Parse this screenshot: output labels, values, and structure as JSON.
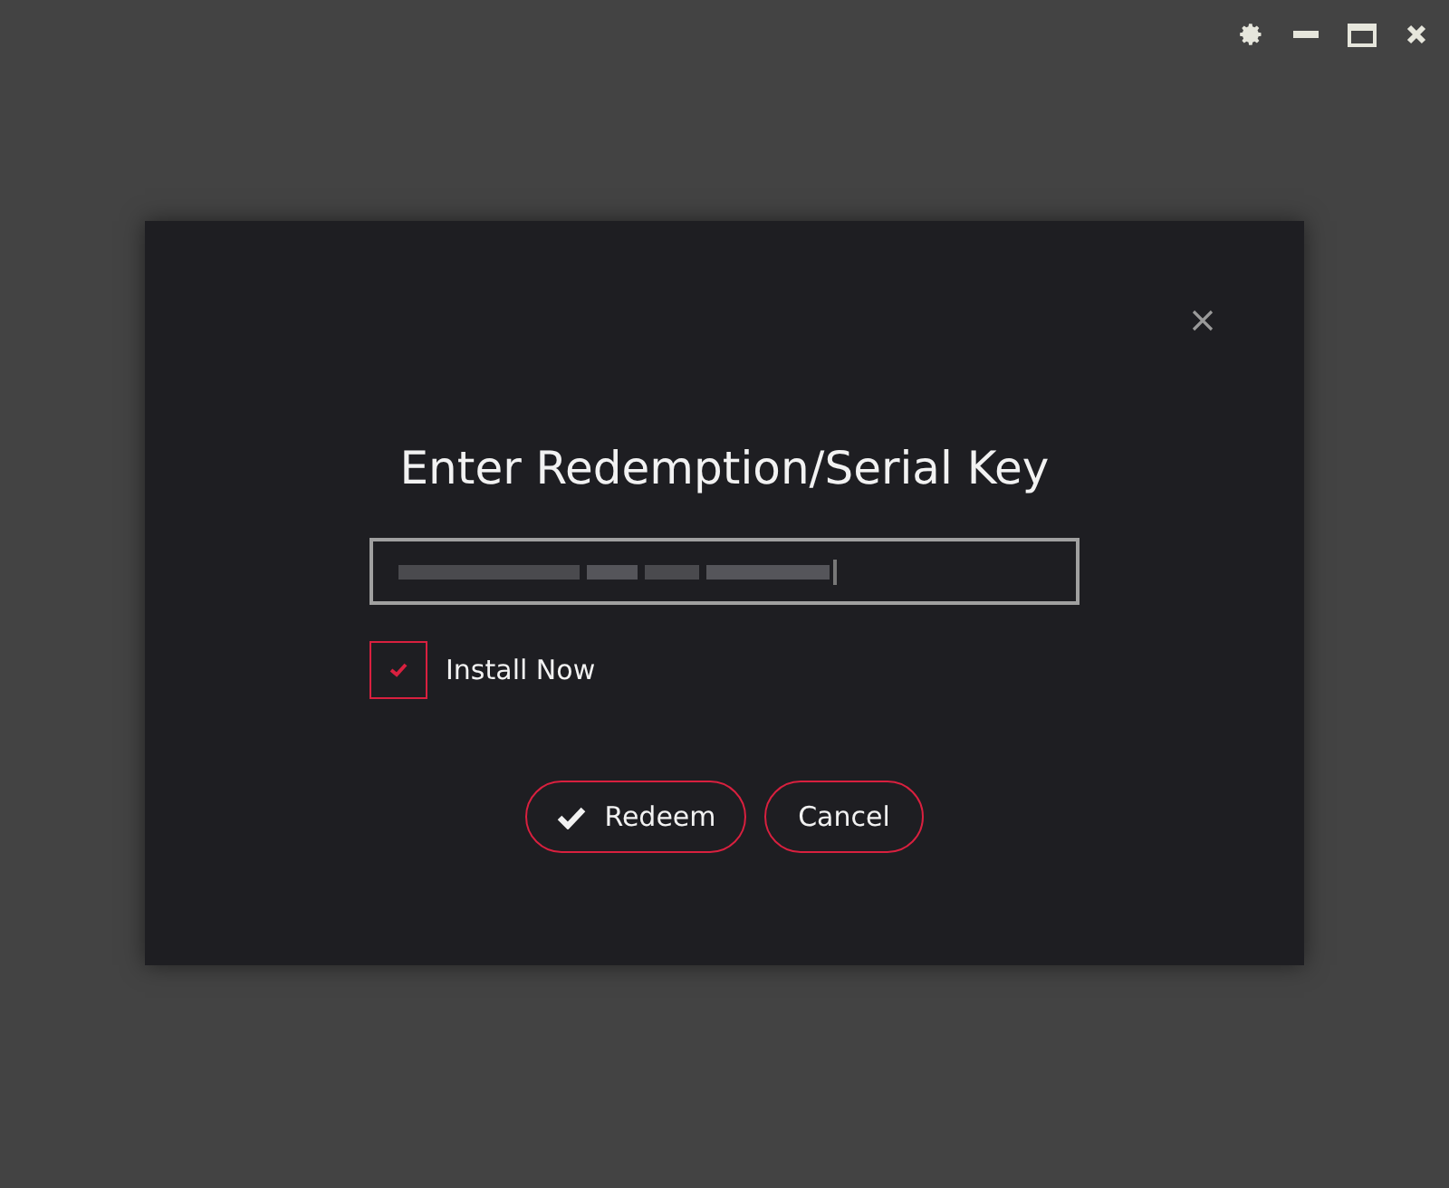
{
  "dialog": {
    "title": "Enter Redemption/Serial Key",
    "install_now": {
      "label": "Install Now",
      "checked": true
    },
    "buttons": [
      {
        "label": "Redeem",
        "kind": "primary"
      },
      {
        "label": "Cancel",
        "kind": "secondary"
      }
    ]
  }
}
